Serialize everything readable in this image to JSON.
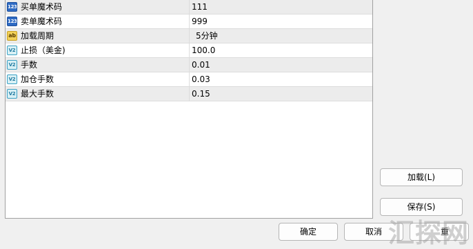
{
  "params": [
    {
      "type": "int",
      "icon_text": "123",
      "name": "买单魔术码",
      "value": "111"
    },
    {
      "type": "int",
      "icon_text": "123",
      "name": "卖单魔术码",
      "value": "999"
    },
    {
      "type": "string",
      "icon_text": "ab",
      "name": "加载周期",
      "value": "5分钟"
    },
    {
      "type": "double",
      "icon_text": "V2",
      "name": "止损（美金)",
      "value": "100.0"
    },
    {
      "type": "double",
      "icon_text": "V2",
      "name": "手数",
      "value": "0.01"
    },
    {
      "type": "double",
      "icon_text": "V2",
      "name": "加仓手数",
      "value": "0.03"
    },
    {
      "type": "double",
      "icon_text": "V2",
      "name": "最大手数",
      "value": "0.15"
    }
  ],
  "buttons": {
    "load": "加载(L)",
    "save": "保存(S)",
    "ok": "确定",
    "cancel": "取消",
    "reset_partial": "重"
  },
  "watermark": "汇探网"
}
